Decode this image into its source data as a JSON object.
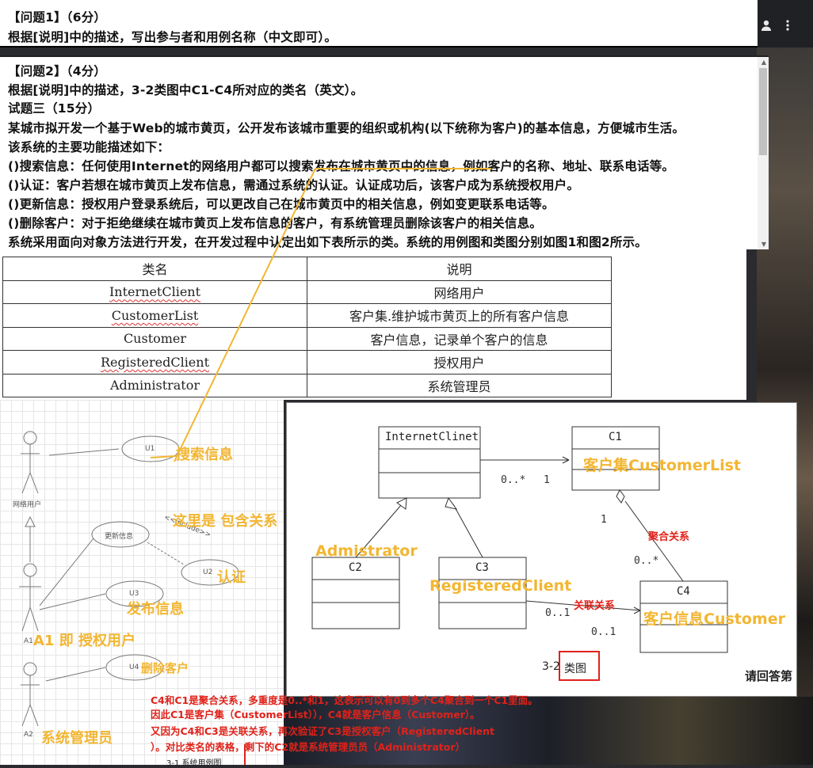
{
  "question1": {
    "title": "【问题1】（6分）",
    "text": "根据[说明]中的描述，写出参与者和用例名称（中文即可）。"
  },
  "question2": {
    "title": "【问题2】（4分）",
    "text": "根据[说明]中的描述，3-2类图中C1-C4所对应的类名（英文）。"
  },
  "exam": {
    "heading": "试题三（15分）",
    "lines": [
      "某城市拟开发一个基于Web的城市黄页，公开发布该城市重要的组织或机构(以下统称为客户)的基本信息，方便城市生活。",
      "该系统的主要功能描述如下：",
      "()搜索信息：任何使用Internet的网络用户都可以搜索发布在城市黄页中的信息，例如客户的名称、地址、联系电话等。",
      "()认证：客户若想在城市黄页上发布信息，需通过系统的认证。认证成功后，该客户成为系统授权用户。",
      "()更新信息：授权用户登录系统后，可以更改自己在城市黄页中的相关信息，例如变更联系电话等。",
      "()删除客户：对于拒绝继续在城市黄页上发布信息的客户，有系统管理员删除该客户的相关信息。",
      "系统采用面向对象方法进行开发，在开发过程中认定出如下表所示的类。系统的用例图和类图分别如图1和图2所示。"
    ]
  },
  "table": {
    "headers": [
      "类名",
      "说明"
    ],
    "rows": [
      [
        "InternetClient",
        "网络用户"
      ],
      [
        "CustomerList",
        "客户集.维护城市黄页上的所有客户信息"
      ],
      [
        "Customer",
        "客户信息，记录单个客户的信息"
      ],
      [
        "RegisteredClient",
        "授权用户"
      ],
      [
        "Administrator",
        "系统管理员"
      ]
    ]
  },
  "usecase": {
    "actor_web": "网络用户",
    "u1": "U1",
    "update": "更新信息",
    "include": "<<include>>",
    "u2": "U2",
    "u3": "U3",
    "u4": "U4",
    "a1": "A1",
    "a2": "A2",
    "caption": "3-1 系统用例图",
    "anno_search": "搜索信息",
    "anno_include": "这里是 包含关系",
    "anno_auth": "认证",
    "anno_publish": "发布信息",
    "anno_a1": "A1 即 授权用户",
    "anno_delete": "删除客户",
    "anno_admin": "系统管理员"
  },
  "classdiagram": {
    "internet": "InternetClinet",
    "c1": "C1",
    "c2": "C2",
    "c3": "C3",
    "c4": "C4",
    "mult_0n_a": "0..*",
    "mult_1_a": "1",
    "mult_1_b": "1",
    "mult_0n_b": "0..*",
    "mult_01_a": "0..1",
    "mult_01_b": "0..1",
    "caption_num": "3-2",
    "caption_text": "类图",
    "anno_c1": "客户集CustomerList",
    "anno_agg": "聚合关系",
    "anno_admin": "Admistrator",
    "anno_reg": "RegisteredClient",
    "anno_assoc": "关联关系",
    "anno_c4": "客户信息Customer",
    "side_text": "请回答第"
  },
  "explanation": {
    "lines": [
      "C4和C1是聚合关系，多重度是0..*和1，这表示可以有0到多个C4聚合到一个C1里面。",
      "因此C1是客户集（CustomerList）），C4就是客户信息（Customer）。",
      "又因为C4和C3是关联关系，再次验证了C3是授权客户（RegisteredClient",
      "）。对比类名的表格，剩下的C2就是系统管理员员（Administrator）"
    ]
  },
  "colors": {
    "annotation_yellow": "#f2b632",
    "annotation_red": "#e0221a"
  }
}
